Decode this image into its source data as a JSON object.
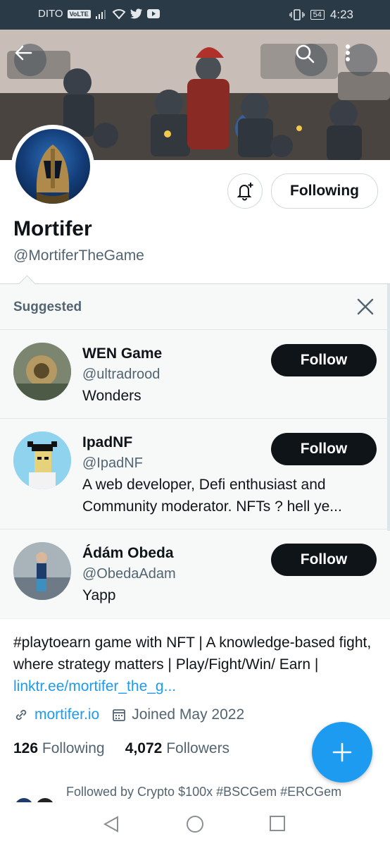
{
  "status_bar": {
    "carrier": "DITO",
    "volte": "VoLTE",
    "battery": "54",
    "time": "4:23"
  },
  "header": {
    "back_icon": "arrow-left-icon",
    "search_icon": "search-icon",
    "more_icon": "more-vertical-icon"
  },
  "profile": {
    "name": "Mortifer",
    "handle": "@MortiferTheGame",
    "following_button": "Following",
    "bio_text": "#playtoearn game with NFT | A knowledge-based fight, where strategy matters | Play/Fight/Win/ Earn | ",
    "bio_link": "linktr.ee/mortifer_the_g...",
    "website": "mortifer.io",
    "joined": "Joined May 2022",
    "following_count": "126",
    "following_label": "Following",
    "followers_count": "4,072",
    "followers_label": "Followers",
    "followed_by": "Followed by Crypto $100x #BSCGem #ERCGem"
  },
  "suggested": {
    "title": "Suggested",
    "items": [
      {
        "name": "WEN Game",
        "handle": "@ultradrood",
        "bio": "Wonders",
        "button": "Follow"
      },
      {
        "name": "IpadNF",
        "handle": "@IpadNF",
        "bio": "A web developer, Defi enthusiast and Community moderator. NFTs ? hell ye...",
        "button": "Follow"
      },
      {
        "name": "Ádám Obeda",
        "handle": "@ObedaAdam",
        "bio": "Yapp",
        "button": "Follow"
      }
    ]
  },
  "colors": {
    "accent": "#1d9bf0",
    "text_primary": "#0f1419",
    "text_secondary": "#536471",
    "status_bar": "#2b3a47"
  }
}
